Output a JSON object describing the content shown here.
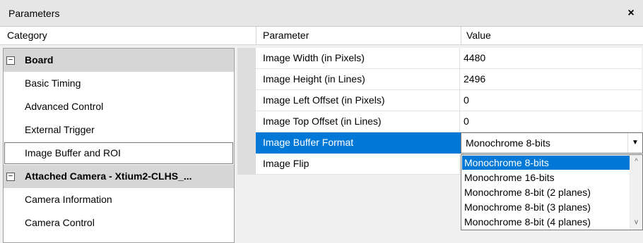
{
  "window": {
    "title": "Parameters",
    "close_label": "×"
  },
  "headers": {
    "category": "Category",
    "parameter": "Parameter",
    "value": "Value"
  },
  "categories": [
    {
      "label": "Board",
      "type": "group",
      "expander": "⊟"
    },
    {
      "label": "Basic Timing",
      "type": "child"
    },
    {
      "label": "Advanced Control",
      "type": "child"
    },
    {
      "label": "External Trigger",
      "type": "child"
    },
    {
      "label": "Image Buffer and ROI",
      "type": "child",
      "selected": true
    },
    {
      "label": "Attached Camera - Xtium2-CLHS_...",
      "type": "group",
      "expander": "⊟"
    },
    {
      "label": "Camera Information",
      "type": "child"
    },
    {
      "label": "Camera Control",
      "type": "child"
    }
  ],
  "parameters": [
    {
      "name": "Image Width (in Pixels)",
      "value": "4480"
    },
    {
      "name": "Image Height (in Lines)",
      "value": "2496"
    },
    {
      "name": "Image Left Offset (in Pixels)",
      "value": "0"
    },
    {
      "name": "Image Top Offset (in Lines)",
      "value": "0"
    },
    {
      "name": "Image Buffer Format",
      "value": "",
      "selected": true
    },
    {
      "name": "Image Flip",
      "value": ""
    }
  ],
  "combo": {
    "value": "Monochrome 8-bits",
    "arrow_icon": "chevron-down-icon"
  },
  "dropdown": {
    "options": [
      "Monochrome 8-bits",
      "Monochrome 16-bits",
      "Monochrome 8-bit (2 planes)",
      "Monochrome 8-bit (3 planes)",
      "Monochrome 8-bit (4 planes)"
    ],
    "highlighted": "Monochrome 8-bits"
  },
  "colors": {
    "selection": "#0078d7",
    "group_bg": "#d6d6d6"
  }
}
